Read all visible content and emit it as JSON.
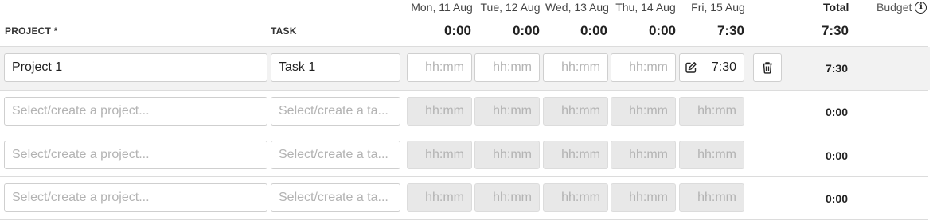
{
  "header": {
    "project_label": "PROJECT *",
    "task_label": "TASK",
    "total_label": "Total",
    "budget_label": "Budget",
    "days": [
      {
        "name": "Mon, 11 Aug",
        "total": "0:00"
      },
      {
        "name": "Tue, 12 Aug",
        "total": "0:00"
      },
      {
        "name": "Wed, 13 Aug",
        "total": "0:00"
      },
      {
        "name": "Thu, 14 Aug",
        "total": "0:00"
      },
      {
        "name": "Fri, 15 Aug",
        "total": "7:30"
      }
    ],
    "grand_total": "7:30"
  },
  "rows": [
    {
      "project": "Project 1",
      "task": "Task 1",
      "times": [
        "hh:mm",
        "hh:mm",
        "hh:mm",
        "hh:mm",
        "7:30"
      ],
      "total": "7:30"
    },
    {
      "project_placeholder": "Select/create a project...",
      "task_placeholder": "Select/create a ta...",
      "times": [
        "hh:mm",
        "hh:mm",
        "hh:mm",
        "hh:mm",
        "hh:mm"
      ],
      "total": "0:00"
    },
    {
      "project_placeholder": "Select/create a project...",
      "task_placeholder": "Select/create a ta...",
      "times": [
        "hh:mm",
        "hh:mm",
        "hh:mm",
        "hh:mm",
        "hh:mm"
      ],
      "total": "0:00"
    },
    {
      "project_placeholder": "Select/create a project...",
      "task_placeholder": "Select/create a ta...",
      "times": [
        "hh:mm",
        "hh:mm",
        "hh:mm",
        "hh:mm",
        "hh:mm"
      ],
      "total": "0:00"
    }
  ],
  "icons": {
    "edit": "edit-icon",
    "delete": "trash-icon",
    "info": "info-icon"
  }
}
